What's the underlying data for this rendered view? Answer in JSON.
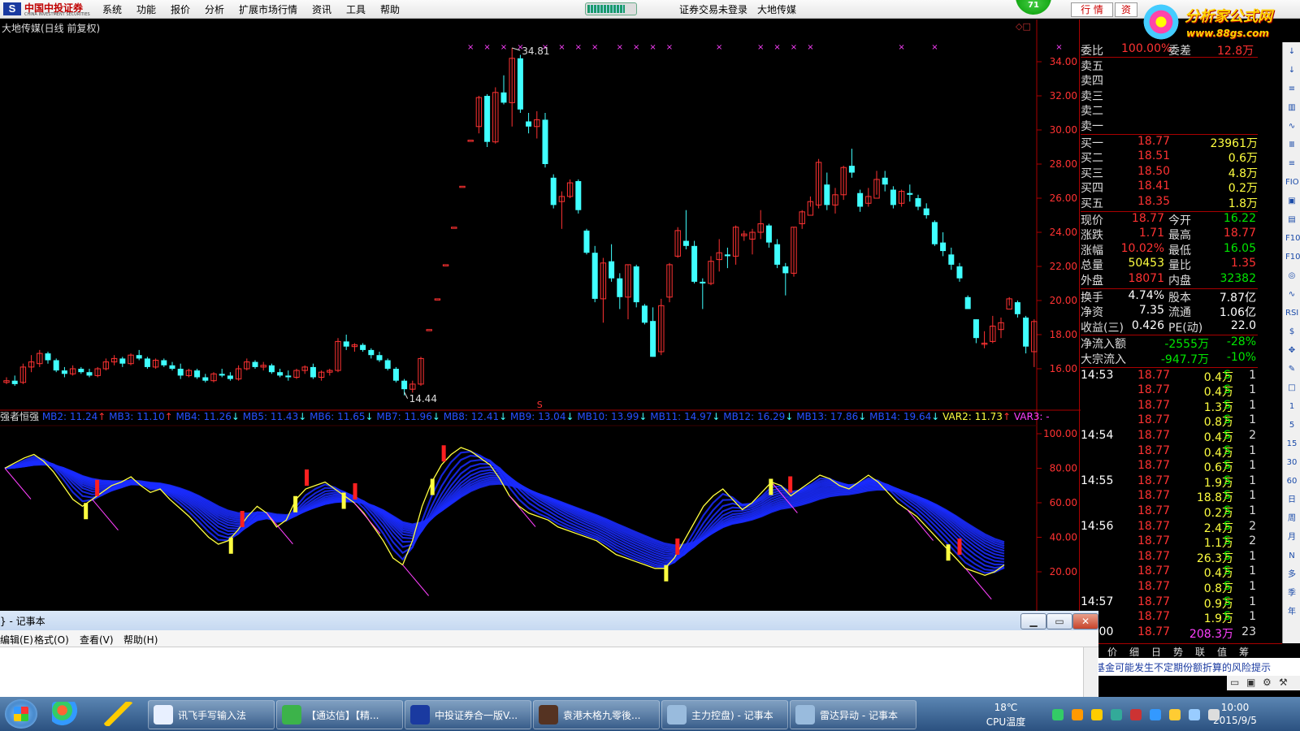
{
  "app": {
    "logo_name": "中国中投证券",
    "logo_sub": "CHINA INVESTMENT SECURITIES",
    "menu": [
      "系统",
      "功能",
      "报价",
      "分析",
      "扩展市场行情",
      "资讯",
      "工具",
      "帮助"
    ],
    "login_status": "证券交易未登录",
    "stock_name": "大地传媒",
    "badge": "71",
    "btn_quote": "行 情",
    "btn_trade": "资",
    "progress": 0.82,
    "watermark_1": "分析家公式网",
    "watermark_2": "www.88gs.com",
    "watermark_faint": "大地传媒"
  },
  "chart": {
    "title": "大地传媒(日线 前复权)",
    "high_label": "34.81",
    "low_label": "14.44",
    "s_marker": "S",
    "price_ticks": [
      "34.00",
      "32.00",
      "30.00",
      "28.00",
      "26.00",
      "24.00",
      "22.00",
      "20.00",
      "18.00",
      "16.00"
    ],
    "osc_ticks": [
      "100.00",
      "80.00",
      "60.00",
      "40.00",
      "20.00"
    ],
    "indicator_name": "强者恒强",
    "indicators": [
      {
        "text": "MB2: 11.24",
        "arrow": "↑",
        "color": "#2850ff",
        "arrow_color": "#ff3232"
      },
      {
        "text": "MB3: 11.10",
        "arrow": "↑",
        "color": "#2850ff",
        "arrow_color": "#ff3232"
      },
      {
        "text": "MB4: 11.26",
        "arrow": "↓",
        "color": "#2850ff",
        "arrow_color": "#40ffff"
      },
      {
        "text": "MB5: 11.43",
        "arrow": "↓",
        "color": "#2850ff",
        "arrow_color": "#40ffff"
      },
      {
        "text": "MB6: 11.65",
        "arrow": "↓",
        "color": "#2850ff",
        "arrow_color": "#40ffff"
      },
      {
        "text": "MB7: 11.96",
        "arrow": "↓",
        "color": "#2850ff",
        "arrow_color": "#40ffff"
      },
      {
        "text": "MB8: 12.41",
        "arrow": "↓",
        "color": "#2850ff",
        "arrow_color": "#40ffff"
      },
      {
        "text": "MB9: 13.04",
        "arrow": "↓",
        "color": "#2850ff",
        "arrow_color": "#40ffff"
      },
      {
        "text": "MB10: 13.99",
        "arrow": "↓",
        "color": "#2850ff",
        "arrow_color": "#40ffff"
      },
      {
        "text": "MB11: 14.97",
        "arrow": "↓",
        "color": "#2850ff",
        "arrow_color": "#40ffff"
      },
      {
        "text": "MB12: 16.29",
        "arrow": "↓",
        "color": "#2850ff",
        "arrow_color": "#40ffff"
      },
      {
        "text": "MB13: 17.86",
        "arrow": "↓",
        "color": "#2850ff",
        "arrow_color": "#40ffff"
      },
      {
        "text": "MB14: 19.64",
        "arrow": "↓",
        "color": "#2850ff",
        "arrow_color": "#40ffff"
      },
      {
        "text": "VAR2: 11.73",
        "arrow": "↑",
        "color": "#ffff40",
        "arrow_color": "#ff3232"
      },
      {
        "text": "VAR3: -",
        "arrow": "",
        "color": "#ff40ff",
        "arrow_color": "#ff40ff"
      }
    ],
    "candles": [
      [
        15.2,
        15.5,
        15.1,
        15.3
      ],
      [
        15.3,
        15.6,
        15.0,
        15.1
      ],
      [
        15.2,
        16.3,
        15.1,
        16.1
      ],
      [
        16.1,
        16.8,
        15.8,
        16.4
      ],
      [
        16.3,
        17.1,
        16.1,
        16.9
      ],
      [
        16.9,
        17.0,
        16.3,
        16.5
      ],
      [
        16.5,
        16.6,
        15.8,
        15.9
      ],
      [
        15.9,
        16.1,
        15.5,
        15.7
      ],
      [
        15.7,
        16.2,
        15.6,
        16.0
      ],
      [
        16.0,
        16.1,
        15.7,
        15.8
      ],
      [
        15.8,
        16.0,
        15.5,
        15.6
      ],
      [
        15.6,
        16.1,
        15.5,
        16.0
      ],
      [
        16.0,
        16.6,
        15.9,
        16.4
      ],
      [
        16.4,
        16.8,
        16.2,
        16.6
      ],
      [
        16.6,
        16.7,
        16.1,
        16.3
      ],
      [
        16.3,
        16.9,
        16.2,
        16.8
      ],
      [
        16.8,
        17.1,
        16.5,
        16.6
      ],
      [
        16.6,
        16.7,
        16.0,
        16.1
      ],
      [
        16.1,
        16.6,
        16.0,
        16.5
      ],
      [
        16.5,
        16.6,
        16.1,
        16.2
      ],
      [
        16.2,
        16.4,
        15.9,
        16.0
      ],
      [
        16.0,
        16.3,
        15.4,
        15.6
      ],
      [
        15.6,
        16.0,
        15.5,
        15.9
      ],
      [
        15.9,
        16.0,
        15.4,
        15.5
      ],
      [
        15.5,
        15.7,
        15.2,
        15.3
      ],
      [
        15.3,
        15.8,
        15.2,
        15.7
      ],
      [
        15.7,
        16.0,
        15.5,
        15.6
      ],
      [
        15.6,
        15.8,
        15.3,
        15.4
      ],
      [
        15.4,
        16.2,
        15.3,
        16.0
      ],
      [
        16.0,
        16.6,
        15.9,
        16.4
      ],
      [
        16.4,
        16.5,
        16.0,
        16.1
      ],
      [
        16.1,
        16.4,
        15.9,
        16.2
      ],
      [
        16.2,
        16.3,
        15.7,
        15.8
      ],
      [
        15.8,
        16.0,
        15.5,
        15.6
      ],
      [
        15.6,
        15.9,
        15.3,
        15.5
      ],
      [
        15.5,
        16.0,
        15.4,
        15.9
      ],
      [
        15.9,
        16.2,
        15.7,
        16.1
      ],
      [
        16.1,
        16.3,
        15.4,
        15.5
      ],
      [
        15.5,
        15.9,
        15.3,
        15.8
      ],
      [
        15.8,
        16.0,
        15.6,
        15.9
      ],
      [
        15.9,
        17.8,
        15.8,
        17.6
      ],
      [
        17.6,
        18.0,
        17.1,
        17.3
      ],
      [
        17.3,
        17.5,
        17.0,
        17.4
      ],
      [
        17.4,
        17.5,
        17.0,
        17.1
      ],
      [
        17.1,
        17.2,
        16.6,
        16.8
      ],
      [
        16.8,
        17.0,
        16.4,
        16.5
      ],
      [
        16.5,
        16.6,
        15.9,
        16.0
      ],
      [
        16.0,
        16.1,
        15.2,
        15.3
      ],
      [
        15.3,
        15.4,
        14.44,
        14.8
      ],
      [
        14.8,
        15.3,
        14.6,
        15.1
      ],
      [
        15.1,
        16.7,
        15.0,
        16.6
      ],
      [
        18.3,
        18.3,
        18.3,
        18.3
      ],
      [
        20.1,
        20.1,
        20.1,
        20.1
      ],
      [
        22.1,
        22.1,
        22.1,
        22.1
      ],
      [
        24.3,
        24.3,
        24.3,
        24.3
      ],
      [
        26.7,
        26.7,
        26.7,
        26.7
      ],
      [
        29.4,
        29.4,
        29.4,
        29.4
      ],
      [
        30.2,
        32.0,
        29.8,
        31.9
      ],
      [
        32.0,
        32.1,
        29.0,
        29.3
      ],
      [
        29.3,
        32.5,
        29.2,
        32.2
      ],
      [
        32.2,
        33.2,
        31.5,
        31.6
      ],
      [
        31.6,
        34.81,
        30.2,
        34.2
      ],
      [
        34.2,
        34.4,
        31.0,
        31.2
      ],
      [
        30.5,
        31.0,
        29.8,
        30.2
      ],
      [
        30.2,
        31.1,
        29.5,
        30.6
      ],
      [
        30.6,
        31.0,
        27.8,
        28.0
      ],
      [
        27.2,
        27.4,
        25.4,
        25.6
      ],
      [
        25.8,
        26.4,
        24.2,
        26.1
      ],
      [
        26.1,
        27.1,
        26.0,
        26.9
      ],
      [
        27.0,
        27.1,
        25.1,
        25.3
      ],
      [
        24.1,
        24.2,
        22.7,
        22.8
      ],
      [
        22.8,
        23.2,
        19.9,
        20.1
      ],
      [
        20.1,
        22.5,
        18.7,
        22.2
      ],
      [
        22.3,
        23.3,
        21.1,
        21.3
      ],
      [
        21.3,
        21.6,
        19.5,
        20.2
      ],
      [
        20.2,
        22.1,
        18.9,
        22.1
      ],
      [
        22.0,
        22.1,
        19.6,
        19.9
      ],
      [
        19.7,
        19.8,
        18.6,
        18.7
      ],
      [
        18.8,
        19.6,
        16.7,
        16.7
      ],
      [
        17.0,
        20.1,
        16.8,
        19.7
      ],
      [
        20.2,
        22.2,
        19.9,
        22.1
      ],
      [
        22.6,
        24.3,
        22.5,
        24.1
      ],
      [
        23.5,
        25.3,
        23.0,
        23.2
      ],
      [
        23.2,
        23.5,
        21.0,
        21.1
      ],
      [
        21.1,
        21.3,
        19.5,
        21.0
      ],
      [
        21.0,
        22.6,
        20.9,
        22.3
      ],
      [
        22.4,
        23.6,
        21.7,
        22.8
      ],
      [
        22.7,
        23.1,
        21.9,
        22.6
      ],
      [
        22.6,
        24.4,
        22.1,
        24.3
      ],
      [
        23.8,
        24.1,
        23.5,
        23.9
      ],
      [
        23.6,
        24.2,
        22.7,
        24.0
      ],
      [
        24.0,
        25.3,
        23.6,
        24.5
      ],
      [
        24.4,
        24.5,
        23.1,
        23.4
      ],
      [
        23.3,
        23.6,
        21.9,
        22.1
      ],
      [
        22.0,
        22.2,
        20.3,
        21.6
      ],
      [
        21.6,
        24.3,
        21.4,
        24.3
      ],
      [
        24.5,
        25.3,
        24.2,
        25.2
      ],
      [
        25.0,
        26.1,
        25.5,
        25.8
      ],
      [
        25.6,
        28.3,
        25.4,
        28.1
      ],
      [
        26.8,
        27.5,
        25.3,
        25.6
      ],
      [
        25.6,
        26.6,
        25.1,
        26.2
      ],
      [
        26.2,
        27.9,
        25.9,
        27.8
      ],
      [
        27.9,
        28.9,
        27.2,
        27.5
      ],
      [
        26.3,
        26.5,
        25.2,
        25.5
      ],
      [
        25.7,
        26.6,
        25.5,
        26.1
      ],
      [
        26.0,
        27.6,
        26.2,
        27.1
      ],
      [
        27.2,
        27.6,
        26.4,
        26.8
      ],
      [
        26.5,
        26.7,
        25.4,
        25.6
      ],
      [
        25.7,
        26.5,
        25.5,
        26.4
      ],
      [
        26.3,
        26.8,
        25.8,
        26.2
      ],
      [
        26.0,
        26.2,
        25.3,
        25.5
      ],
      [
        25.4,
        25.7,
        24.8,
        25.0
      ],
      [
        24.6,
        24.7,
        23.2,
        23.3
      ],
      [
        23.4,
        24.0,
        22.6,
        22.9
      ],
      [
        22.7,
        23.1,
        21.8,
        22.1
      ],
      [
        22.0,
        22.2,
        21.1,
        21.3
      ],
      [
        20.2,
        20.3,
        19.5,
        19.5
      ],
      [
        18.9,
        18.9,
        17.5,
        17.8
      ],
      [
        17.5,
        18.2,
        17.2,
        17.5
      ],
      [
        17.6,
        19.1,
        17.5,
        18.5
      ],
      [
        18.3,
        19.0,
        17.8,
        18.7
      ],
      [
        19.5,
        20.2,
        19.7,
        20.1
      ],
      [
        19.9,
        20.0,
        19.0,
        19.2
      ],
      [
        19.0,
        19.1,
        16.9,
        17.3
      ],
      [
        17.0,
        18.9,
        16.1,
        18.77
      ]
    ],
    "osc_close": [
      80,
      83,
      86,
      88,
      84,
      78,
      70,
      62,
      58,
      62,
      66,
      70,
      72,
      75,
      70,
      66,
      68,
      62,
      57,
      52,
      46,
      40,
      36,
      38,
      44,
      52,
      58,
      54,
      46,
      50,
      62,
      68,
      70,
      72,
      68,
      64,
      60,
      54,
      46,
      38,
      28,
      24,
      38,
      58,
      72,
      82,
      88,
      92,
      90,
      86,
      82,
      74,
      64,
      58,
      54,
      52,
      50,
      46,
      44,
      42,
      40,
      38,
      34,
      30,
      28,
      26,
      24,
      22,
      22,
      28,
      38,
      48,
      58,
      64,
      68,
      62,
      56,
      60,
      66,
      72,
      70,
      64,
      68,
      72,
      76,
      74,
      70,
      68,
      72,
      76,
      72,
      66,
      60,
      56,
      52,
      46,
      40,
      34,
      28,
      22,
      20,
      18,
      20,
      24
    ],
    "buy_marks": [
      10,
      28,
      36,
      42,
      53,
      82,
      95,
      117
    ],
    "sell_marks": [
      11,
      29,
      37,
      43,
      54,
      83,
      97,
      118
    ],
    "x_marks": [
      56,
      58,
      60,
      62,
      65,
      67,
      69,
      71,
      74,
      76,
      78,
      80,
      86,
      91,
      93,
      95,
      97,
      108,
      112,
      127
    ]
  },
  "quote": {
    "wei_bi_lbl": "委比",
    "wei_bi": "100.00%",
    "wei_cha_lbl": "委差",
    "wei_cha": "12.8万",
    "sell": [
      {
        "lbl": "卖五"
      },
      {
        "lbl": "卖四"
      },
      {
        "lbl": "卖三"
      },
      {
        "lbl": "卖二"
      },
      {
        "lbl": "卖一"
      }
    ],
    "buy": [
      {
        "lbl": "买一",
        "price": "18.77",
        "vol": "23961万"
      },
      {
        "lbl": "买二",
        "price": "18.51",
        "vol": "0.6万"
      },
      {
        "lbl": "买三",
        "price": "18.50",
        "vol": "4.8万"
      },
      {
        "lbl": "买四",
        "price": "18.41",
        "vol": "0.2万"
      },
      {
        "lbl": "买五",
        "price": "18.35",
        "vol": "1.8万"
      }
    ],
    "stats": [
      {
        "l1": "现价",
        "v1": "18.77",
        "c1": "red",
        "l2": "今开",
        "v2": "16.22",
        "c2": "green"
      },
      {
        "l1": "涨跌",
        "v1": "1.71",
        "c1": "red",
        "l2": "最高",
        "v2": "18.77",
        "c2": "red"
      },
      {
        "l1": "涨幅",
        "v1": "10.02%",
        "c1": "red",
        "l2": "最低",
        "v2": "16.05",
        "c2": "green"
      },
      {
        "l1": "总量",
        "v1": "50453",
        "c1": "yellow",
        "l2": "量比",
        "v2": "1.35",
        "c2": "red"
      },
      {
        "l1": "外盘",
        "v1": "18071",
        "c1": "red",
        "l2": "内盘",
        "v2": "32382",
        "c2": "green"
      },
      {
        "l1": "换手",
        "v1": "4.74%",
        "c1": "white",
        "l2": "股本",
        "v2": "7.87亿",
        "c2": "white"
      },
      {
        "l1": "净资",
        "v1": "7.35",
        "c1": "white",
        "l2": "流通",
        "v2": "1.06亿",
        "c2": "white"
      },
      {
        "l1": "收益(三)",
        "v1": "0.426",
        "c1": "white",
        "l2": "PE(动)",
        "v2": "22.0",
        "c2": "white"
      }
    ],
    "flow": [
      {
        "lbl": "净流入额",
        "v": "-2555万",
        "p": "-28%"
      },
      {
        "lbl": "大宗流入",
        "v": "-947.7万",
        "p": "-10%"
      }
    ],
    "ticks": [
      {
        "t": "14:53",
        "p": "18.77",
        "v": "0.4万",
        "s": "S",
        "n": "1"
      },
      {
        "t": "",
        "p": "18.77",
        "v": "0.4万",
        "s": "S",
        "n": "1"
      },
      {
        "t": "",
        "p": "18.77",
        "v": "1.3万",
        "s": "S",
        "n": "1"
      },
      {
        "t": "",
        "p": "18.77",
        "v": "0.8万",
        "s": "S",
        "n": "1"
      },
      {
        "t": "14:54",
        "p": "18.77",
        "v": "0.4万",
        "s": "S",
        "n": "2"
      },
      {
        "t": "",
        "p": "18.77",
        "v": "0.4万",
        "s": "S",
        "n": "1"
      },
      {
        "t": "",
        "p": "18.77",
        "v": "0.6万",
        "s": "S",
        "n": "1"
      },
      {
        "t": "14:55",
        "p": "18.77",
        "v": "1.9万",
        "s": "S",
        "n": "1"
      },
      {
        "t": "",
        "p": "18.77",
        "v": "18.8万",
        "s": "S",
        "n": "1"
      },
      {
        "t": "",
        "p": "18.77",
        "v": "0.2万",
        "s": "S",
        "n": "1"
      },
      {
        "t": "14:56",
        "p": "18.77",
        "v": "2.4万",
        "s": "S",
        "n": "2"
      },
      {
        "t": "",
        "p": "18.77",
        "v": "1.1万",
        "s": "S",
        "n": "2"
      },
      {
        "t": "",
        "p": "18.77",
        "v": "26.3万",
        "s": "S",
        "n": "1"
      },
      {
        "t": "",
        "p": "18.77",
        "v": "0.4万",
        "s": "S",
        "n": "1"
      },
      {
        "t": "",
        "p": "18.77",
        "v": "0.8万",
        "s": "S",
        "n": "1"
      },
      {
        "t": "14:57",
        "p": "18.77",
        "v": "0.9万",
        "s": "S",
        "n": "1"
      },
      {
        "t": "",
        "p": "18.77",
        "v": "1.9万",
        "s": "S",
        "n": "1"
      },
      {
        "t": "15:00",
        "p": "18.77",
        "v": "208.3万",
        "s": "",
        "n": "23"
      }
    ],
    "tabs": [
      "笔",
      "价",
      "细",
      "日",
      "势",
      "联",
      "值",
      "筹"
    ],
    "ticker": "级基金可能发生不定期份额折算的风险提示"
  },
  "side_tools": [
    "↓",
    "↓",
    "≡",
    "▥",
    "∿",
    "Ⅲ",
    "≡",
    "FIO",
    "▣",
    "▤",
    "F10",
    "F10",
    "◎",
    "∿",
    "RSI",
    "$",
    "✥",
    "✎",
    "□",
    "1",
    "5",
    "15",
    "30",
    "60",
    "日",
    "周",
    "月",
    "N",
    "多",
    "季",
    "年"
  ],
  "notepad": {
    "title": "} - 记事本",
    "menu": [
      "编辑(E)",
      "格式(O)",
      "查看(V)",
      "帮助(H)"
    ],
    "btn_min": "▁",
    "btn_max": "▭",
    "btn_close": "✕"
  },
  "taskbar": {
    "tasks": [
      {
        "label": "讯飞手写输入法",
        "color": "#e8f0ff"
      },
      {
        "label": "【通达信】【精...",
        "color": "#3cb34a"
      },
      {
        "label": "中投证券合一版V...",
        "color": "#1a3aa0"
      },
      {
        "label": "袁港木格九零後...",
        "color": "#553322"
      },
      {
        "label": "主力控盘) - 记事本",
        "color": "#9bd"
      },
      {
        "label": "雷达异动 - 记事本",
        "color": "#9bd"
      }
    ],
    "temp": "18℃",
    "temp_lbl": "CPU温度",
    "time": "10:00",
    "date": "2015/9/5"
  }
}
